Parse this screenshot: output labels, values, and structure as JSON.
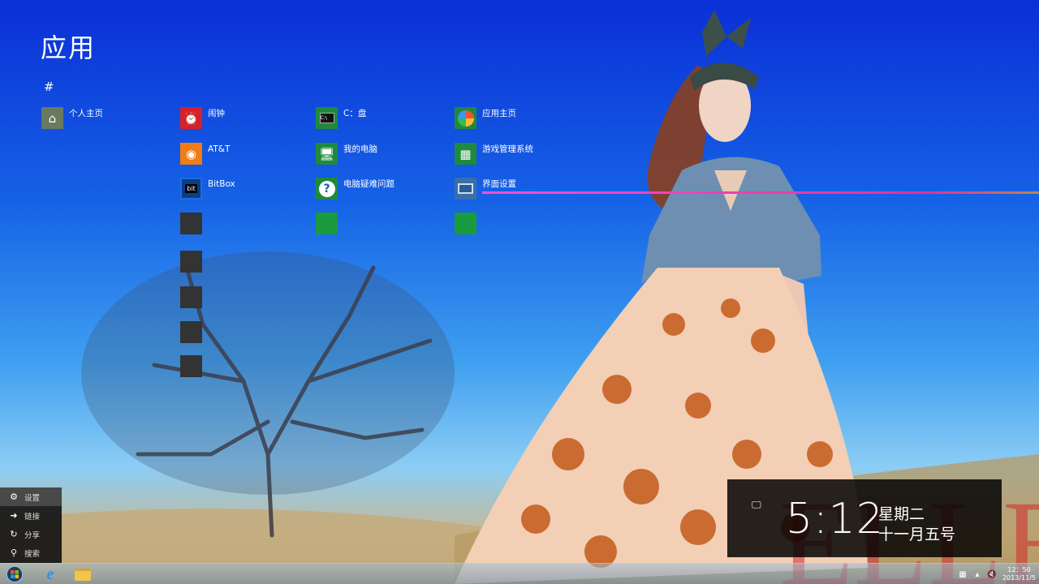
{
  "screen": {
    "title": "应用",
    "group_header": "#"
  },
  "tiles": [
    {
      "label": "个人主页",
      "icon": "personal-home-icon",
      "color": "#6b7a5e"
    },
    {
      "label": "闹钟",
      "icon": "alarm-clock-icon",
      "color": "#d81f2c"
    },
    {
      "label": "AT&T",
      "icon": "att-globe-icon",
      "color": "#f07c17"
    },
    {
      "label": "BitBox",
      "icon": "bitbox-icon",
      "color": "#0b3d8a"
    },
    {
      "label": "C：盘",
      "icon": "console-icon",
      "color": "#1f8a3d"
    },
    {
      "label": "我的电脑",
      "icon": "computer-icon",
      "color": "#1f8a3d"
    },
    {
      "label": "电脑疑难问题",
      "icon": "help-icon",
      "color": "#1f8a3d"
    },
    {
      "label": "应用主页",
      "icon": "app-home-icon",
      "color": "#1f8a3d"
    },
    {
      "label": "游戏管理系统",
      "icon": "game-manager-icon",
      "color": "#1f8a3d"
    },
    {
      "label": "界面设置",
      "icon": "display-settings-icon",
      "color": "#3a6fa8"
    }
  ],
  "blank_tile_colors": {
    "gray": "#333333",
    "green": "#1a9b3e"
  },
  "charms": [
    {
      "label": "设置",
      "icon": "gear-icon"
    },
    {
      "label": "链接",
      "icon": "devices-icon"
    },
    {
      "label": "分享",
      "icon": "share-icon"
    },
    {
      "label": "搜索",
      "icon": "search-icon"
    }
  ],
  "clock": {
    "time": "5:12",
    "day": "星期二",
    "date": "十一月五号"
  },
  "taskbar": {
    "tray_time": "12：50",
    "tray_date": "2013/11/5"
  }
}
